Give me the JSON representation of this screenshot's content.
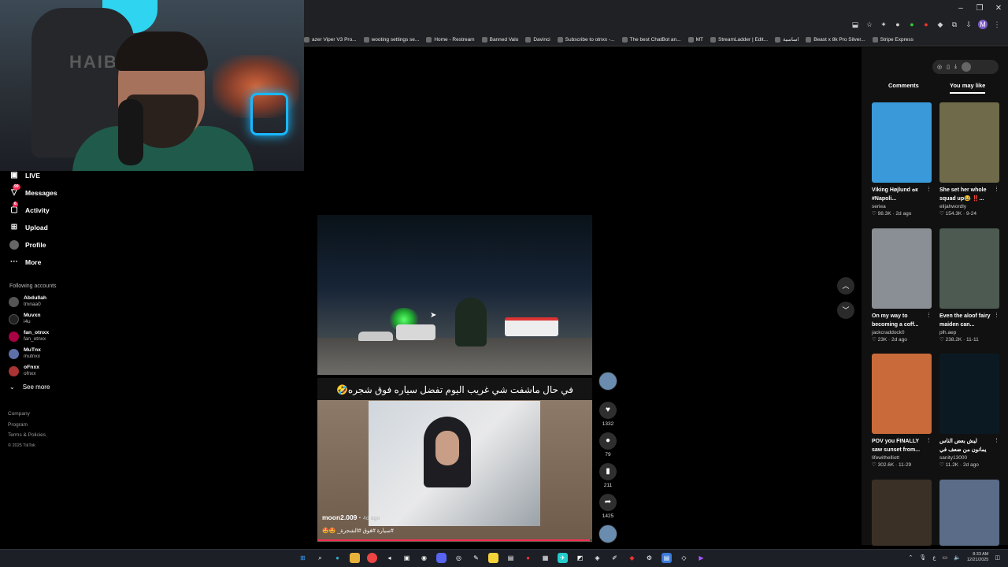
{
  "browser": {
    "bookmarks": [
      {
        "label": "azer Viper V3 Pro..."
      },
      {
        "label": "wooting settings se..."
      },
      {
        "label": "Home - Restream"
      },
      {
        "label": "Banned Valo"
      },
      {
        "label": "Davinci"
      },
      {
        "label": "Subscribe to otnxx -..."
      },
      {
        "label": "The best ChatBot an..."
      },
      {
        "label": "MT"
      },
      {
        "label": "StreamLadder | Edit..."
      },
      {
        "label": "اساسية"
      },
      {
        "label": "Beast x 8k Pro Silver..."
      },
      {
        "label": "Stripe Express"
      }
    ],
    "profile_initial": "M"
  },
  "webcam": {
    "chair_text": "HAIBK"
  },
  "sidebar": {
    "items": [
      {
        "label": "LIVE",
        "icon": "live-icon"
      },
      {
        "label": "Messages",
        "icon": "messages-icon",
        "badge": "99"
      },
      {
        "label": "Activity",
        "icon": "activity-icon",
        "badge": "6"
      },
      {
        "label": "Upload",
        "icon": "upload-icon"
      },
      {
        "label": "Profile",
        "icon": "profile-icon"
      },
      {
        "label": "More",
        "icon": "more-icon"
      }
    ],
    "following_title": "Following accounts",
    "following": [
      {
        "name": "Abdullah",
        "user": "tmnaa0"
      },
      {
        "name": "Muvxn",
        "user": "i4u"
      },
      {
        "name": "fan_otnxx",
        "user": "fan_otnxx"
      },
      {
        "name": "MuTnx",
        "user": "mutnxx"
      },
      {
        "name": "oFnxx",
        "user": "ofnxx"
      }
    ],
    "see_more": "See more",
    "footer": {
      "company": "Company",
      "program": "Program",
      "terms": "Terms & Policies",
      "copyright": "© 2025 TikTok"
    }
  },
  "video": {
    "overlay_caption": "في حال ماشفت شي غريب اليوم تفضل سياره فوق شجره🤣",
    "author": "moon2.009",
    "age": "4d ago",
    "caption": "#سيارة #فوق #الشجرة_ 🤩🤩",
    "progress": 0.99,
    "likes": "1332",
    "comments": "79",
    "saves": "211",
    "shares": "1425"
  },
  "right_panel": {
    "tabs": [
      "Comments",
      "You may like"
    ],
    "active_tab": "You may like",
    "cards": [
      {
        "title": "Viking Højlund ๐к #Napoli...",
        "author": "seriea",
        "likes": "98.3K",
        "date": "2d ago",
        "color": "#3a9ad9"
      },
      {
        "title": "She set her whole squad up😂 ‼️...",
        "author": "elijahwordly",
        "likes": "154.3K",
        "date": "9-24",
        "color": "#6e6a4a"
      },
      {
        "title": "On my way to becoming a coff...",
        "author": "jackcraddock0",
        "likes": "23K",
        "date": "2d ago",
        "color": "#8a8f95"
      },
      {
        "title": "Even the aloof fairy maiden can...",
        "author": "plh.aep",
        "likes": "238.2K",
        "date": "11-11",
        "color": "#4c5a52"
      },
      {
        "title": "POV you FINALLY saw sunset from...",
        "author": "lifewithelliott",
        "likes": "302.6K",
        "date": "11-29",
        "color": "#c96a3a"
      },
      {
        "title": "ليش بعض الناس يمانون من ضعف في الذاكرة او ينسون",
        "author": "sanity13000",
        "likes": "11.2K",
        "date": "2d ago",
        "color": "#0b1a22"
      },
      {
        "title": "",
        "author": "",
        "likes": "",
        "date": "",
        "color": "#3a3026"
      },
      {
        "title": "",
        "author": "",
        "likes": "",
        "date": "",
        "color": "#5a6c88"
      }
    ]
  },
  "taskbar": {
    "time": "8:33 AM",
    "date": "12/21/2025"
  }
}
